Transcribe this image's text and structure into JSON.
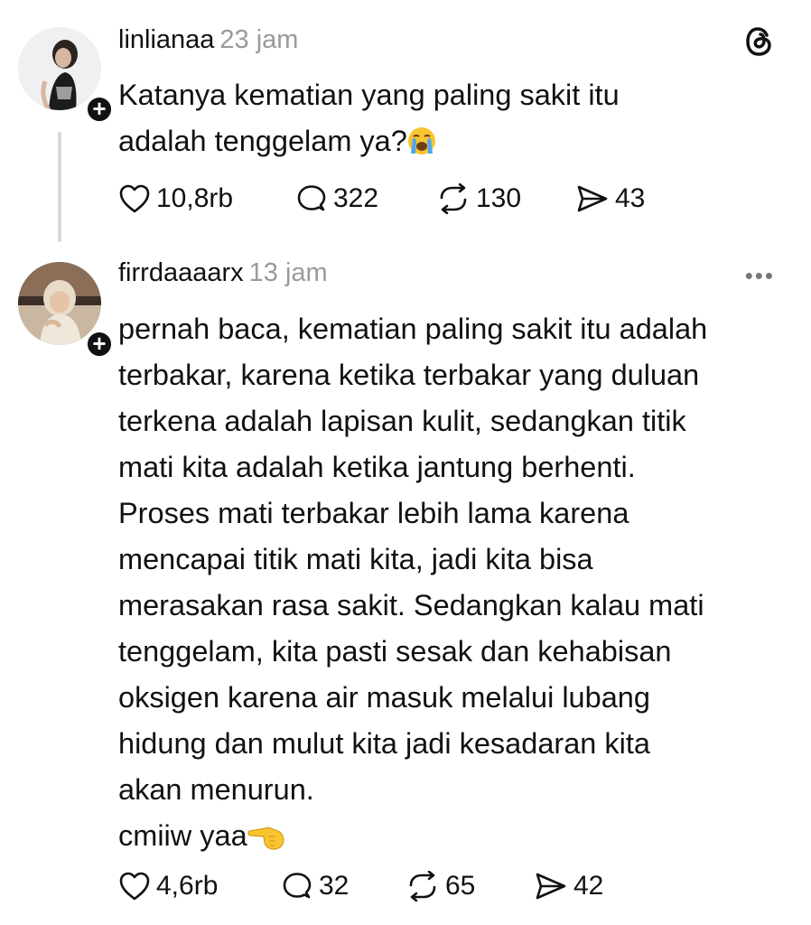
{
  "posts": [
    {
      "username": "linlianaa",
      "time": "23 jam",
      "text_lines": [
        "Katanya kematian yang paling sakit itu",
        "adalah tenggelam ya?"
      ],
      "emoji": "loudly-crying-face",
      "stats": {
        "likes": "10,8rb",
        "replies": "322",
        "reposts": "130",
        "shares": "43"
      }
    },
    {
      "username": "firrdaaaarx",
      "time": "13 jam",
      "text_lines": [
        "pernah baca, kematian paling sakit itu adalah",
        "terbakar, karena ketika terbakar yang duluan",
        "terkena adalah lapisan kulit, sedangkan titik",
        "mati kita adalah ketika jantung berhenti.",
        "Proses mati terbakar lebih lama karena",
        "mencapai titik mati kita, jadi kita bisa",
        "merasakan rasa sakit. Sedangkan kalau mati",
        "tenggelam, kita pasti sesak dan kehabisan",
        "oksigen karena air masuk melalui lubang",
        "hidung dan mulut kita jadi kesadaran kita",
        "akan menurun.",
        "cmiiw yaa"
      ],
      "emoji": "backhand-pointing-left",
      "stats": {
        "likes": "4,6rb",
        "replies": "32",
        "reposts": "65",
        "shares": "42"
      }
    }
  ],
  "icons": {
    "header_right_post1": "threads-logo-icon",
    "header_right_post2": "more-options-icon",
    "follow_badge": "+"
  }
}
